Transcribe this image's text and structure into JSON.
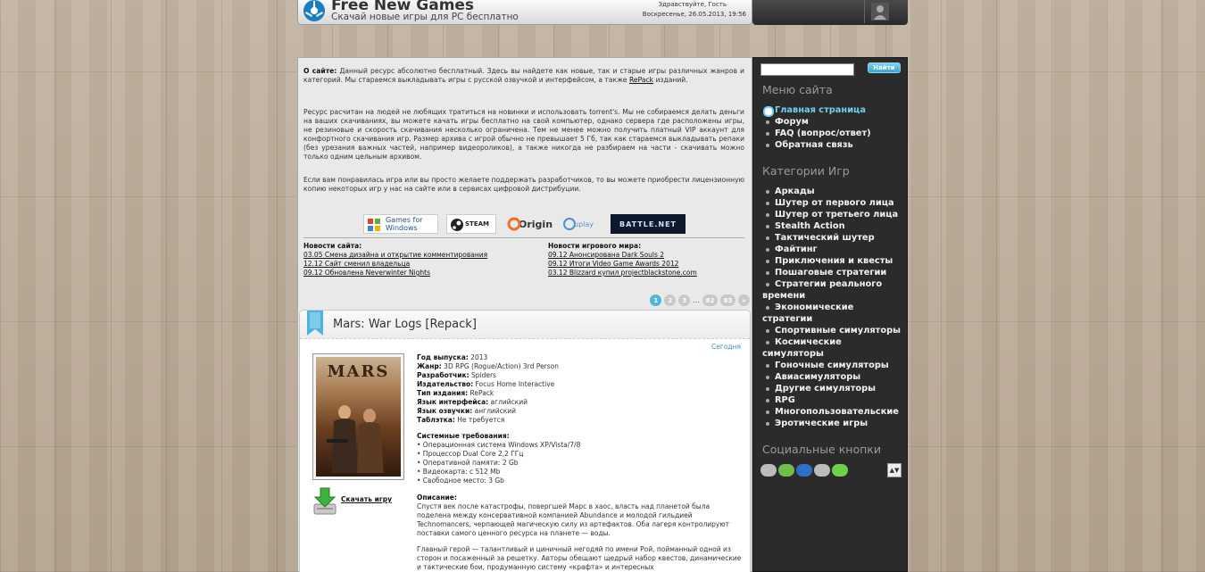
{
  "header": {
    "title": "Free New Games",
    "subtitle": "Скачай новые игры для PC бесплатно",
    "greeting": "Здравствуйте, Гость",
    "datetime": "Воскресенье, 26.05.2013, 19:56"
  },
  "content": {
    "about_label": "О сайте:",
    "about_text": " Данный ресурс абсолютно бесплатный. Здесь вы найдете как новые, так и старые игры различных жанров и категорий. Мы стараемся выкладывать игры с русской озвучкой и интерфейсом, а также ",
    "about_link": "RePack",
    "about_tail": " изданий.",
    "para2": "Ресурс расчитан на людей не любящих тратиться на новинки и использовать torrent's. Мы не собираемся делать деньги на ваших скачиваниях, вы можете качать игры бесплатно на свой компьютер, однако сервера где расположены игры, не резиновые и скорость скачивания несколько ограничена. Тем не менее можно получить платный VIP аккаунт для конфортного скачивания игр. Размер архива с игрой обычно не превышает 5 Гб, так как стараемся выкладывать репаки (без урезания важных частей, например видеороликов), а также никогда не разбираем на части - скачивать можно только одним цельным архивом.",
    "para3": "Если вам понравилась игра или вы просто желаете поддержать разработчиков, то вы можете приобрести лицензионную копию некоторых игр у нас на сайте или в сервисах цифровой дистрибуции.",
    "stores": {
      "gfw": "Games for Windows",
      "steam": "STEAM",
      "origin": "Origin",
      "uplay": "uplay",
      "battlenet": "BATTLE.NET"
    },
    "news_site": {
      "heading": "Новости сайта:",
      "items": [
        "03.05 Смена дизайна и открытие комментирования",
        "12.12 Сайт сменил владельца",
        "09.12 Обновлена Neverwinter Nights"
      ]
    },
    "news_world": {
      "heading": "Новости игрового мира:",
      "items": [
        "09.12 Анонсирована Dark Souls 2",
        "09.12 Итоги Video Game Awards 2012",
        "03.12 Blizzard купил projectblackstone.com"
      ]
    },
    "pagination": [
      "1",
      "2",
      "3",
      "...",
      "82",
      "83",
      "»"
    ]
  },
  "entry": {
    "title": "Mars: War Logs [Repack]",
    "date": "Сегодня",
    "cover_title": "MARS",
    "download_label": "Скачать игру",
    "fields": [
      {
        "label": "Год выпуска:",
        "value": " 2013"
      },
      {
        "label": "Жанр:",
        "value": " 3D RPG (Rogue/Action) 3rd Person"
      },
      {
        "label": "Разработчик:",
        "value": " Spiders"
      },
      {
        "label": "Издательство:",
        "value": " Focus Home Interactive"
      },
      {
        "label": "Тип издания:",
        "value": " RePack"
      },
      {
        "label": "Язык интерфейса:",
        "value": " аглийский"
      },
      {
        "label": "Язык озвучки:",
        "value": " английский"
      },
      {
        "label": "Таблэтка:",
        "value": " Не требуется"
      }
    ],
    "sysreq_label": "Системные требования:",
    "sysreq": [
      "• Операционная система Windows XP/Vista/7/8",
      "• Процессор Dual Core 2,2 ГГц",
      "• Оперативной памяти: 2 Gb",
      "• Видеокарта: с 512 Mb",
      "• Свободное место: 3 Gb"
    ],
    "description_label": "Описание:",
    "description_p1": "Спустя век после катастрофы, повергшей Марс в хаос, власть над планетой была поделена между консервативной компанией Abundance и молодой гильдией Technomancers, черпающей магическую силу из артефактов. Оба лагеря контролируют поставки самого ценного ресурса на планете — воды.",
    "description_p2": "Главный герой — талантливый и циничный негодяй по имени Рой, пойманный одной из сторон и посаженный за решетку. Авторы обещают щедрый набор квестов, динамические и тактические бои, продуманную систему «крафта» и интересных"
  },
  "sidebar": {
    "search_placeholder": "",
    "search_button": "Найти",
    "menu_heading": "Меню сайта",
    "menu": [
      "Главная страница",
      "Форум",
      "FAQ (вопрос/ответ)",
      "Обратная связь"
    ],
    "categories_heading": "Категории Игр",
    "categories": [
      "Аркады",
      "Шутер от первого лица",
      "Шутер от третьего лица",
      "Stealth Action",
      "Тактический шутер",
      "Файтинг",
      "Приключения и квесты",
      "Пошаговые стратегии",
      "Стратегии реального времени",
      "Экономические стратегии",
      "Спортивные симуляторы",
      "Космические симуляторы",
      "Гоночные симуляторы",
      "Авиасимуляторы",
      "Другие симуляторы",
      "RPG",
      "Многопользовательские",
      "Эротические игры"
    ],
    "social_heading": "Социальные кнопки",
    "scroll_glyph": "▲▼"
  },
  "colors": {
    "accent": "#50b8d6",
    "sidebar_bg": "#2b2b2b",
    "link_active": "#6fd0f0"
  }
}
